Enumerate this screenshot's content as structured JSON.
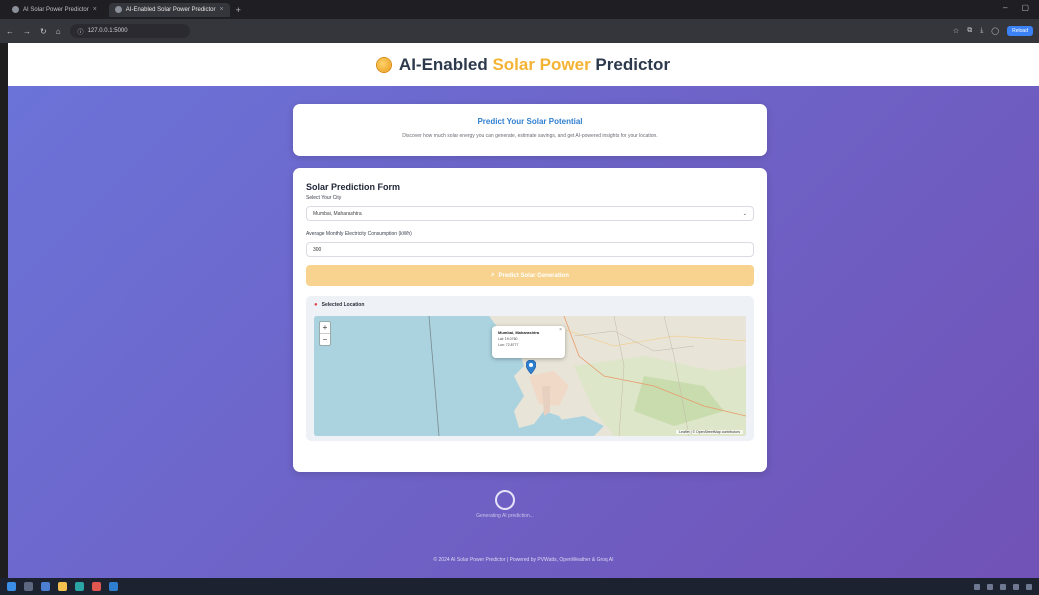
{
  "browser": {
    "tabs": [
      {
        "label": "AI Solar Power Predictor"
      },
      {
        "label": "AI-Enabled Solar Power Predictor"
      }
    ],
    "url": "127.0.0.1:5000",
    "extension_button": "Reload"
  },
  "header": {
    "title_prefix": "AI-Enabled ",
    "title_highlight": "Solar Power",
    "title_suffix": " Predictor"
  },
  "hero": {
    "title": "Predict Your Solar Potential",
    "subtitle": "Discover how much solar energy you can generate, estimate savings, and get AI-powered insights for your location."
  },
  "form": {
    "title": "Solar Prediction Form",
    "city_label": "Select Your City",
    "city_value": "Mumbai, Maharashtra",
    "consumption_label": "Average Monthly Electricity Consumption (kWh)",
    "consumption_value": "300",
    "button_label": "Predict Solar Generation",
    "button_icon": "search-icon"
  },
  "location": {
    "title": "Selected Location",
    "popup_name": "Mumbai, Maharashtra",
    "popup_lat": "Lat: 19.0760",
    "popup_lon": "Lon: 72.8777",
    "attribution": "Leaflet | © OpenStreetMap contributors"
  },
  "loading": {
    "text": "Generating AI prediction..."
  },
  "footer": {
    "text": "© 2024 AI Solar Power Predictor | Powered by PVWatts, OpenWeather & Groq AI"
  },
  "colors": {
    "accent": "#f5b335",
    "hero_title": "#2f7fd1",
    "gradient_start": "#6b74d9",
    "gradient_end": "#7152b6"
  }
}
